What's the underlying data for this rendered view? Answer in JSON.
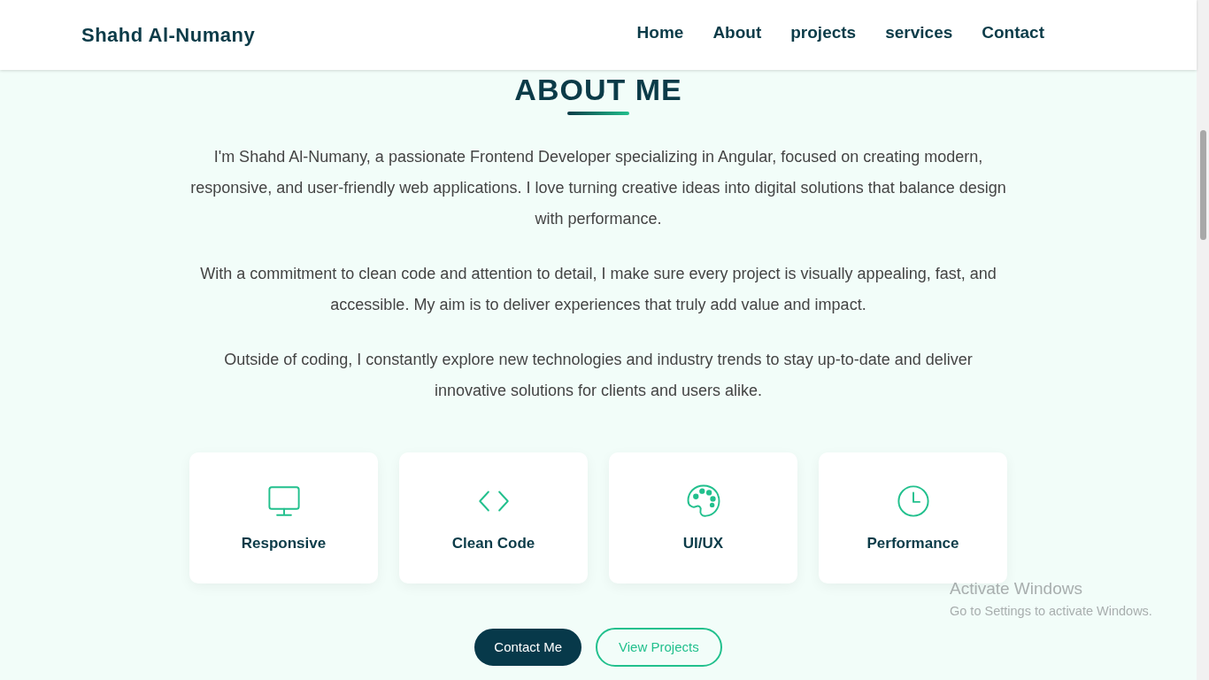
{
  "brand": "Shahd Al-Numany",
  "nav": [
    "Home",
    "About",
    "projects",
    "services",
    "Contact"
  ],
  "heading": "ABOUT ME",
  "paragraphs": [
    "I'm Shahd Al-Numany, a passionate Frontend Developer specializing in Angular, focused on creating modern, responsive, and user-friendly web applications. I love turning creative ideas into digital solutions that balance design with performance.",
    "With a commitment to clean code and attention to detail, I make sure every project is visually appealing, fast, and accessible. My aim is to deliver experiences that truly add value and impact.",
    "Outside of coding, I constantly explore new technologies and industry trends to stay up-to-date and deliver innovative solutions for clients and users alike."
  ],
  "features": [
    "Responsive",
    "Clean Code",
    "UI/UX",
    "Performance"
  ],
  "buttons": [
    {
      "label": "Contact Me",
      "kind": "primary"
    },
    {
      "label": "View Projects",
      "kind": "outline"
    }
  ],
  "activation": {
    "title": "Activate Windows",
    "subtitle": "Go to Settings to activate Windows."
  }
}
